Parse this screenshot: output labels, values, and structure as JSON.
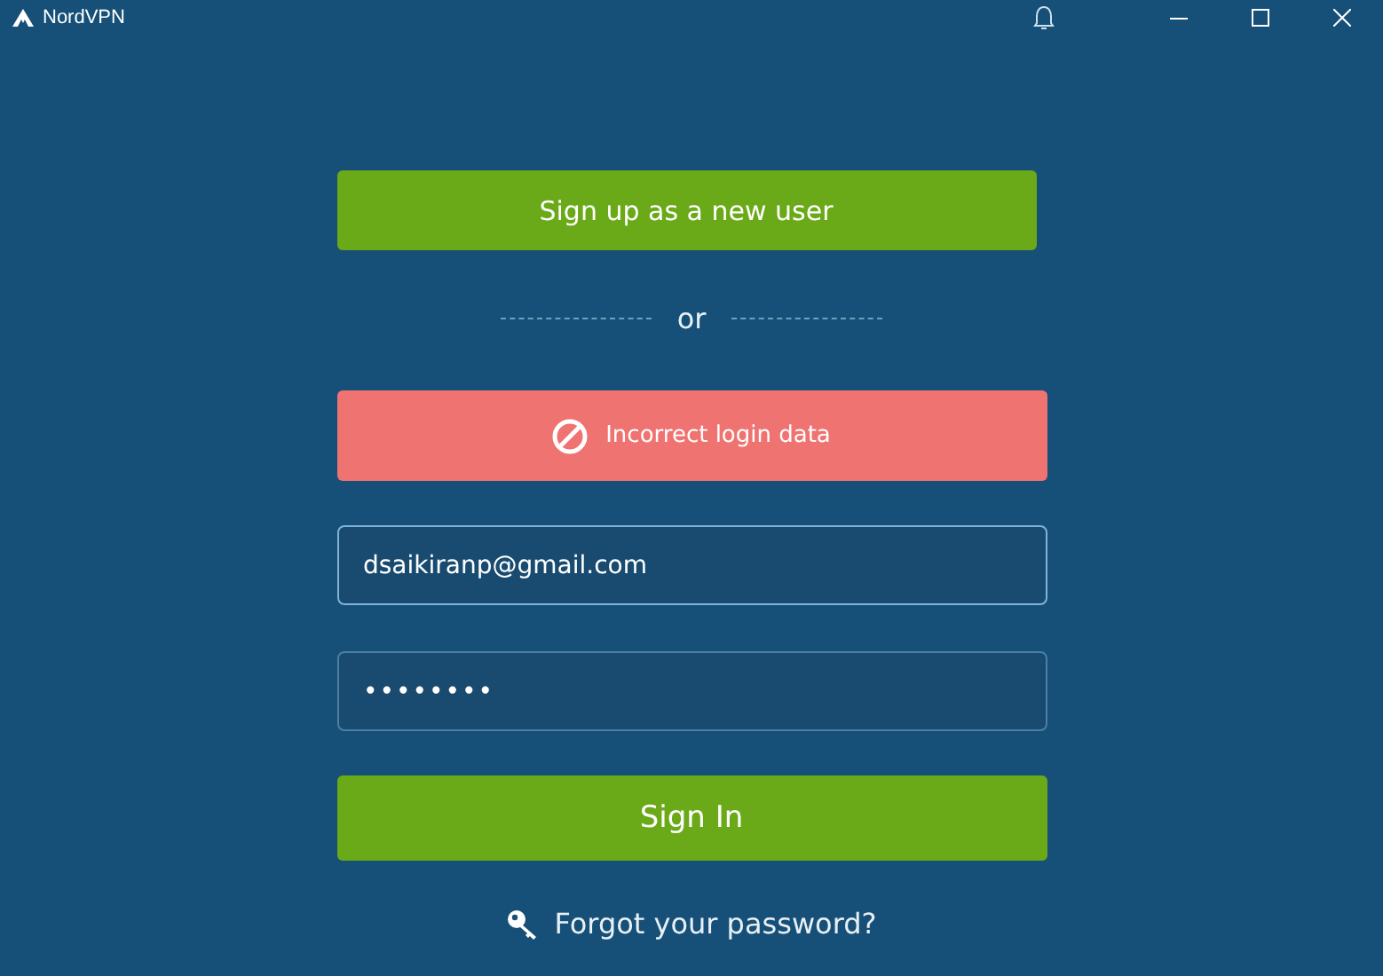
{
  "window": {
    "title": "NordVPN"
  },
  "signup_button": "Sign up as a new user",
  "divider": "or",
  "error": {
    "message": "Incorrect login data"
  },
  "email": {
    "value": "dsaikiranp@gmail.com"
  },
  "password": {
    "value": "••••••••"
  },
  "signin_button": "Sign In",
  "forgot_link": "Forgot your password?"
}
